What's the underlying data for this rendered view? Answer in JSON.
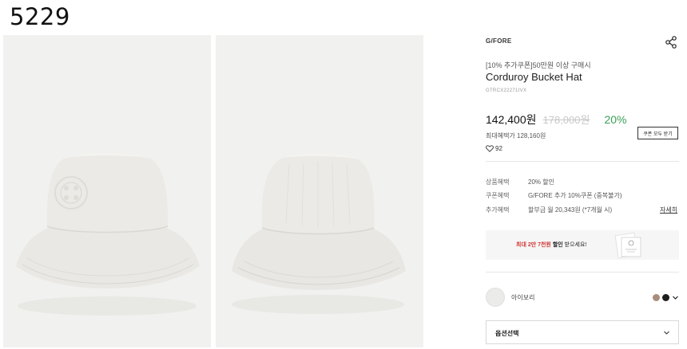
{
  "screenshot_number": "5229",
  "product": {
    "brand": "G/FORE",
    "promo_line": "[10% 추가쿠폰]50만원 이상 구매시",
    "title": "Corduroy Bucket Hat",
    "sku": "GTRCX22271IVX",
    "sale_price": "142,400원",
    "original_price": "178,000원",
    "discount_rate": "20%",
    "coupon_button": "쿠폰 모두 받기",
    "max_benefit": "최대혜택가 128,160원",
    "wish_count": "92"
  },
  "benefits": [
    {
      "label": "상품혜택",
      "value": "20% 할인"
    },
    {
      "label": "쿠폰혜택",
      "value": "G/FORE 추가 10%쿠폰 (중복불가)"
    },
    {
      "label": "추가혜택",
      "value": "할부금 월 20,343원 (*7개월 시)"
    }
  ],
  "detail_link": "자세히",
  "banner": {
    "highlight": "최대 2만 7천원",
    "bold": "할인",
    "rest": " 받으세요!"
  },
  "color": {
    "selected_name": "아이보리",
    "swatches": [
      "#a88d7c",
      "#1e1e1e"
    ]
  },
  "option_select": {
    "label": "옵션선택"
  },
  "icons": {
    "share": "share-icon",
    "heart": "heart-icon",
    "chevron": "chevron-down-icon"
  }
}
